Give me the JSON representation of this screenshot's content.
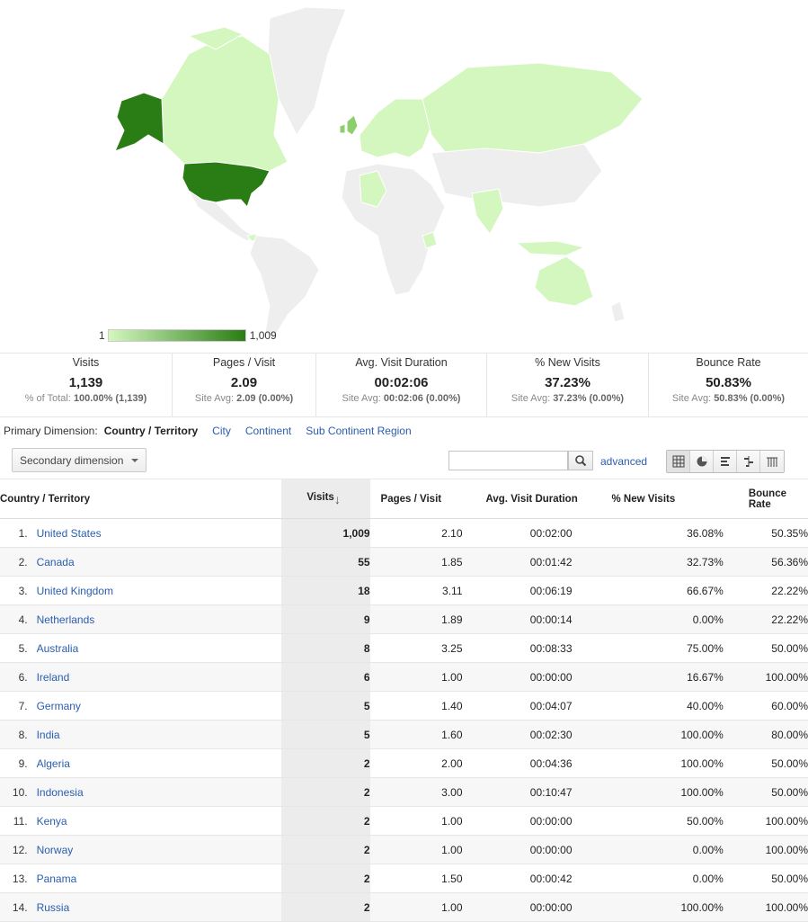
{
  "legend": {
    "min": "1",
    "max": "1,009"
  },
  "colors": {
    "high": "#2a7d14",
    "mid": "#8dcf6a",
    "low": "#d4f7c0",
    "none": "#eeeeee",
    "link": "#2a5db0"
  },
  "summary": [
    {
      "title": "Visits",
      "value": "1,139",
      "sub_label": "% of Total:",
      "sub_value": "100.00% (1,139)"
    },
    {
      "title": "Pages / Visit",
      "value": "2.09",
      "sub_label": "Site Avg:",
      "sub_value": "2.09 (0.00%)"
    },
    {
      "title": "Avg. Visit Duration",
      "value": "00:02:06",
      "sub_label": "Site Avg:",
      "sub_value": "00:02:06 (0.00%)"
    },
    {
      "title": "% New Visits",
      "value": "37.23%",
      "sub_label": "Site Avg:",
      "sub_value": "37.23% (0.00%)"
    },
    {
      "title": "Bounce Rate",
      "value": "50.83%",
      "sub_label": "Site Avg:",
      "sub_value": "50.83% (0.00%)"
    }
  ],
  "dimensions": {
    "label": "Primary Dimension:",
    "active": "Country / Territory",
    "links": [
      "City",
      "Continent",
      "Sub Continent Region"
    ]
  },
  "toolbar": {
    "secondary_dimension": "Secondary dimension",
    "search_value": "",
    "advanced": "advanced",
    "view_icons": [
      "grid-view-icon",
      "pie-view-icon",
      "bar-view-icon",
      "comparison-view-icon",
      "pivot-view-icon"
    ]
  },
  "table": {
    "headers": {
      "country": "Country / Territory",
      "visits": "Visits",
      "sort_arrow": "↓",
      "pages": "Pages / Visit",
      "duration": "Avg. Visit Duration",
      "new_visits": "% New Visits",
      "bounce": "Bounce Rate"
    },
    "rows": [
      {
        "idx": "1.",
        "country": "United States",
        "visits": "1,009",
        "pages": "2.10",
        "duration": "00:02:00",
        "new": "36.08%",
        "bounce": "50.35%"
      },
      {
        "idx": "2.",
        "country": "Canada",
        "visits": "55",
        "pages": "1.85",
        "duration": "00:01:42",
        "new": "32.73%",
        "bounce": "56.36%"
      },
      {
        "idx": "3.",
        "country": "United Kingdom",
        "visits": "18",
        "pages": "3.11",
        "duration": "00:06:19",
        "new": "66.67%",
        "bounce": "22.22%"
      },
      {
        "idx": "4.",
        "country": "Netherlands",
        "visits": "9",
        "pages": "1.89",
        "duration": "00:00:14",
        "new": "0.00%",
        "bounce": "22.22%"
      },
      {
        "idx": "5.",
        "country": "Australia",
        "visits": "8",
        "pages": "3.25",
        "duration": "00:08:33",
        "new": "75.00%",
        "bounce": "50.00%"
      },
      {
        "idx": "6.",
        "country": "Ireland",
        "visits": "6",
        "pages": "1.00",
        "duration": "00:00:00",
        "new": "16.67%",
        "bounce": "100.00%"
      },
      {
        "idx": "7.",
        "country": "Germany",
        "visits": "5",
        "pages": "1.40",
        "duration": "00:04:07",
        "new": "40.00%",
        "bounce": "60.00%"
      },
      {
        "idx": "8.",
        "country": "India",
        "visits": "5",
        "pages": "1.60",
        "duration": "00:02:30",
        "new": "100.00%",
        "bounce": "80.00%"
      },
      {
        "idx": "9.",
        "country": "Algeria",
        "visits": "2",
        "pages": "2.00",
        "duration": "00:04:36",
        "new": "100.00%",
        "bounce": "50.00%"
      },
      {
        "idx": "10.",
        "country": "Indonesia",
        "visits": "2",
        "pages": "3.00",
        "duration": "00:10:47",
        "new": "100.00%",
        "bounce": "50.00%"
      },
      {
        "idx": "11.",
        "country": "Kenya",
        "visits": "2",
        "pages": "1.00",
        "duration": "00:00:00",
        "new": "50.00%",
        "bounce": "100.00%"
      },
      {
        "idx": "12.",
        "country": "Norway",
        "visits": "2",
        "pages": "1.00",
        "duration": "00:00:00",
        "new": "0.00%",
        "bounce": "100.00%"
      },
      {
        "idx": "13.",
        "country": "Panama",
        "visits": "2",
        "pages": "1.50",
        "duration": "00:00:42",
        "new": "0.00%",
        "bounce": "50.00%"
      },
      {
        "idx": "14.",
        "country": "Russia",
        "visits": "2",
        "pages": "1.00",
        "duration": "00:00:00",
        "new": "100.00%",
        "bounce": "100.00%"
      }
    ]
  }
}
